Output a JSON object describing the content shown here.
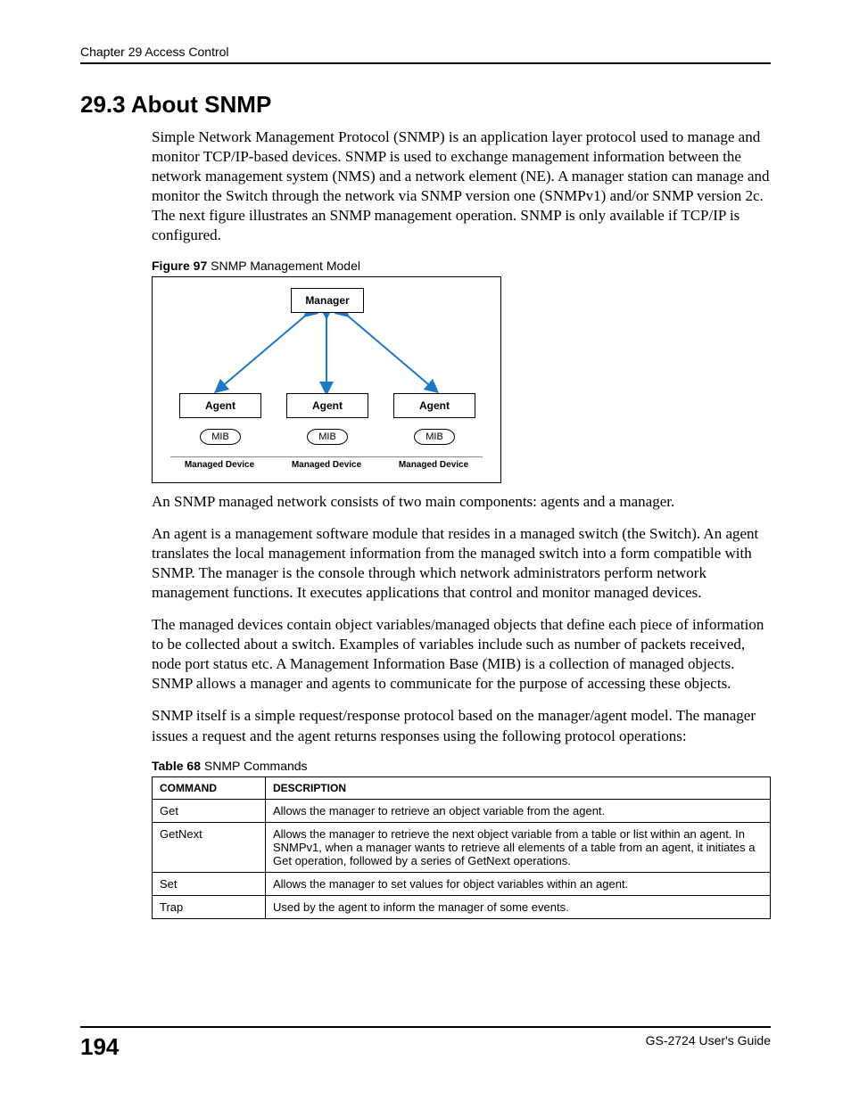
{
  "header": {
    "chapter": "Chapter 29 Access Control"
  },
  "heading": "29.3  About SNMP",
  "paragraphs": {
    "p1": "Simple Network Management Protocol (SNMP) is an application layer protocol used to manage and monitor TCP/IP-based devices. SNMP is used to exchange management information between the network management system (NMS) and a network element (NE). A manager station can manage and monitor the Switch through the network via SNMP version one (SNMPv1) and/or SNMP version 2c. The next figure illustrates an SNMP management operation. SNMP is only available if TCP/IP is configured.",
    "p2": "An SNMP managed network consists of two main components: agents and a manager.",
    "p3": "An agent is a management software module that resides in a managed switch (the Switch). An agent translates the local management information from the managed switch into a form compatible with SNMP. The manager is the console through which network administrators perform network management functions. It executes applications that control and monitor managed devices.",
    "p4": "The managed devices contain object variables/managed objects that define each piece of information to be collected about a switch. Examples of variables include such as number of packets received, node port status etc. A Management Information Base (MIB) is a collection of managed objects. SNMP allows a manager and agents to communicate for the purpose of accessing these objects.",
    "p5": "SNMP itself is a simple request/response protocol based on the manager/agent model. The manager issues a request and the agent returns responses using the following protocol operations:"
  },
  "figure": {
    "label_bold": "Figure 97",
    "label_rest": "   SNMP Management Model",
    "manager": "Manager",
    "agent": "Agent",
    "mib": "MIB",
    "managed_device": "Managed Device"
  },
  "table": {
    "label_bold": "Table 68",
    "label_rest": "   SNMP Commands",
    "headers": {
      "c1": "COMMAND",
      "c2": "DESCRIPTION"
    },
    "rows": [
      {
        "cmd": "Get",
        "desc": "Allows the manager to retrieve an object variable from the agent."
      },
      {
        "cmd": "GetNext",
        "desc": "Allows the manager to retrieve the next object variable from a table or list within an agent. In SNMPv1, when a manager wants to retrieve all elements of a table from an agent, it initiates a Get operation, followed by a series of GetNext operations."
      },
      {
        "cmd": "Set",
        "desc": "Allows the manager to set values for object variables within an agent."
      },
      {
        "cmd": "Trap",
        "desc": "Used by the agent to inform the manager of some events."
      }
    ]
  },
  "footer": {
    "page": "194",
    "guide": "GS-2724 User's Guide"
  }
}
